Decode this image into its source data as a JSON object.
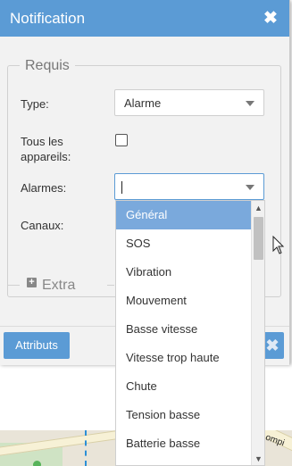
{
  "dialog": {
    "title": "Notification",
    "close_glyph": "✖"
  },
  "form": {
    "legend": "Requis",
    "type_label": "Type:",
    "type_value": "Alarme",
    "all_devices_label_line1": "Tous les",
    "all_devices_label_line2": "appareils:",
    "all_devices_checked": false,
    "alarms_label": "Alarmes:",
    "alarms_value": "",
    "channels_label": "Canaux:"
  },
  "extra": {
    "label": "Extra",
    "icon": "plus-square-icon"
  },
  "footer": {
    "attributes_button": "Attributs",
    "close_glyph": "✖"
  },
  "dropdown": {
    "options": [
      "Général",
      "SOS",
      "Vibration",
      "Mouvement",
      "Basse vitesse",
      "Vitesse trop haute",
      "Chute",
      "Tension basse",
      "Batterie basse"
    ],
    "highlighted_index": 0
  },
  "map": {
    "visible_label": "ompi"
  },
  "colors": {
    "accent": "#5b9bd5",
    "highlight": "#7aa9dc",
    "panel": "#f2f2f2"
  }
}
